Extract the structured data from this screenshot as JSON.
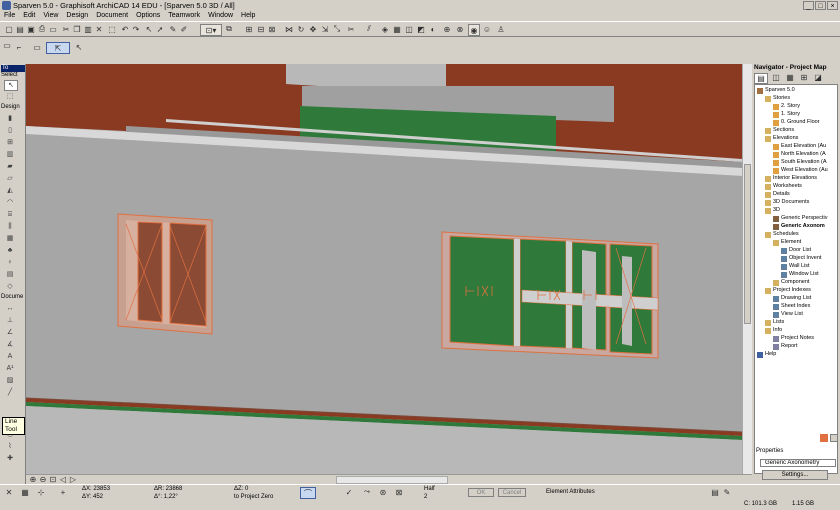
{
  "window": {
    "title": "Sparven 5.0 - Graphisoft ArchiCAD 14 EDU - [Sparven 5.0 3D / All]",
    "min_label": "_",
    "max_label": "□",
    "close_label": "×"
  },
  "menu": [
    "File",
    "Edit",
    "View",
    "Design",
    "Document",
    "Options",
    "Teamwork",
    "Window",
    "Help"
  ],
  "toolbox": {
    "header": "To",
    "select_label": "Select",
    "design_label": "Design",
    "document_label": "Docume",
    "tooltip": "Line Tool"
  },
  "navigator": {
    "title": "Navigator - Project Map",
    "tree": [
      {
        "label": "Sparven 5.0",
        "level": 0,
        "icon": "project-icon"
      },
      {
        "label": "Stories",
        "level": 1,
        "icon": "folder-icon"
      },
      {
        "label": "2. Story",
        "level": 2,
        "icon": "story-icon"
      },
      {
        "label": "1. Story",
        "level": 2,
        "icon": "story-icon"
      },
      {
        "label": "0. Ground Floor",
        "level": 2,
        "icon": "story-icon"
      },
      {
        "label": "Sections",
        "level": 1,
        "icon": "folder-icon"
      },
      {
        "label": "Elevations",
        "level": 1,
        "icon": "folder-icon"
      },
      {
        "label": "East Elevation (Au",
        "level": 2,
        "icon": "elevation-icon"
      },
      {
        "label": "North Elevation (A",
        "level": 2,
        "icon": "elevation-icon"
      },
      {
        "label": "South Elevation (A",
        "level": 2,
        "icon": "elevation-icon"
      },
      {
        "label": "West Elevation (Au",
        "level": 2,
        "icon": "elevation-icon"
      },
      {
        "label": "Interior Elevations",
        "level": 1,
        "icon": "folder-icon"
      },
      {
        "label": "Worksheets",
        "level": 1,
        "icon": "folder-icon"
      },
      {
        "label": "Details",
        "level": 1,
        "icon": "folder-icon"
      },
      {
        "label": "3D Documents",
        "level": 1,
        "icon": "folder-icon"
      },
      {
        "label": "3D",
        "level": 1,
        "icon": "folder-icon"
      },
      {
        "label": "Generic Perspectiv",
        "level": 2,
        "icon": "perspective-icon"
      },
      {
        "label": "Generic Axonom",
        "level": 2,
        "icon": "axonometry-icon",
        "selected": true
      },
      {
        "label": "Schedules",
        "level": 1,
        "icon": "folder-icon"
      },
      {
        "label": "Element",
        "level": 2,
        "icon": "folder-icon"
      },
      {
        "label": "Door List",
        "level": 3,
        "icon": "list-icon"
      },
      {
        "label": "Object Invent",
        "level": 3,
        "icon": "list-icon"
      },
      {
        "label": "Wall List",
        "level": 3,
        "icon": "list-icon"
      },
      {
        "label": "Window List",
        "level": 3,
        "icon": "list-icon"
      },
      {
        "label": "Component",
        "level": 2,
        "icon": "folder-icon"
      },
      {
        "label": "Project Indexes",
        "level": 1,
        "icon": "folder-icon"
      },
      {
        "label": "Drawing List",
        "level": 2,
        "icon": "list-icon"
      },
      {
        "label": "Sheet Index",
        "level": 2,
        "icon": "list-icon"
      },
      {
        "label": "View List",
        "level": 2,
        "icon": "list-icon"
      },
      {
        "label": "Lists",
        "level": 1,
        "icon": "folder-icon"
      },
      {
        "label": "Info",
        "level": 1,
        "icon": "folder-icon"
      },
      {
        "label": "Project Notes",
        "level": 2,
        "icon": "note-icon"
      },
      {
        "label": "Report",
        "level": 2,
        "icon": "note-icon"
      },
      {
        "label": "Help",
        "level": 0,
        "icon": "help-icon"
      }
    ],
    "properties_label": "Properties",
    "properties_value": "Generic Axonometry",
    "settings_label": "Settings..."
  },
  "status": {
    "dx": "ΔX: 23853",
    "dy": "ΔY: 452",
    "ar": "ΔR: 23868",
    "angle": "Δ°: 1,22°",
    "dz": "ΔZ: 0",
    "ref": "to Project Zero",
    "half_label": "Half",
    "half_value": "2",
    "ok_label": "OK",
    "cancel_label": "Cancel",
    "element_attributes": "Element Attributes",
    "disk": "C: 101.3 GB",
    "ram": "1.15 GB"
  },
  "colors": {
    "roof_red": "#8b3a22",
    "wall_grey": "#a8a8a8",
    "frame_orange": "#e07040",
    "glass_green": "#2f7a3a",
    "roof_green": "#2f7a3a"
  }
}
